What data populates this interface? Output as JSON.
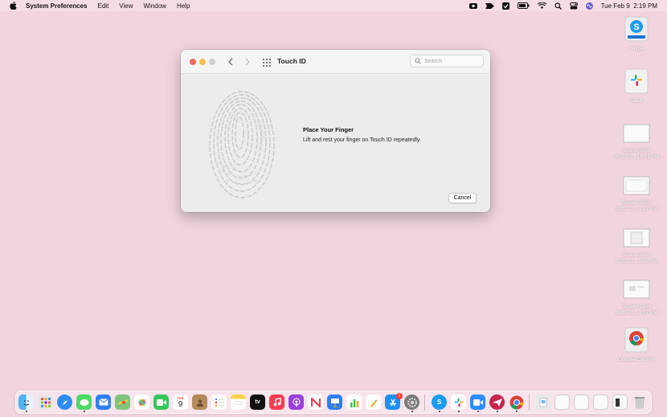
{
  "menubar": {
    "app_name": "System Preferences",
    "menus": [
      "Edit",
      "View",
      "Window",
      "Help"
    ],
    "datetime": "Tue Feb 9  2:19 PM",
    "status_icons": [
      "screen-record-icon",
      "dropzone-icon",
      "checkmark-app-icon",
      "battery-icon",
      "wifi-icon",
      "spotlight-icon",
      "control-center-icon",
      "siri-icon"
    ]
  },
  "window": {
    "title": "Touch ID",
    "search": {
      "placeholder": "Search",
      "value": ""
    },
    "prompt_title": "Place Your Finger",
    "prompt_desc": "Lift and rest your finger on Touch ID repeatedly.",
    "cancel_label": "Cancel"
  },
  "desktop": [
    {
      "label": "Skype"
    },
    {
      "label": "Slack"
    },
    {
      "label": "Screen Shot\n2021-02...18.19 PM"
    },
    {
      "label": "Screen Shot\n2021-02...8.27 PM"
    },
    {
      "label": "Screen Shot\n2021-02...8.38 PM"
    },
    {
      "label": "Screen Shot\n2021-02...9.07 PM"
    },
    {
      "label": "Google Chrome"
    }
  ],
  "dock": {
    "calendar": {
      "month": "FEB",
      "day": "9"
    },
    "appletv_label": "tv",
    "app_store_badge": "1",
    "apps": [
      "Finder",
      "Launchpad",
      "Safari",
      "Messages",
      "Mail",
      "Maps",
      "Photos",
      "FaceTime",
      "Calendar",
      "Contacts",
      "Reminders",
      "Notes",
      "TV",
      "Music",
      "Podcasts",
      "News",
      "Keynote",
      "Numbers",
      "Pages",
      "App Store",
      "System Preferences",
      "Skype",
      "Slack",
      "Zoom",
      "Airmail",
      "Chrome",
      "Preview",
      "Screen Shot",
      "Screen Shot",
      "Screen Shot",
      "Screen Shot",
      "Trash"
    ]
  },
  "colors": {
    "desktop": "#f2d4de",
    "accent": "#147efb"
  }
}
